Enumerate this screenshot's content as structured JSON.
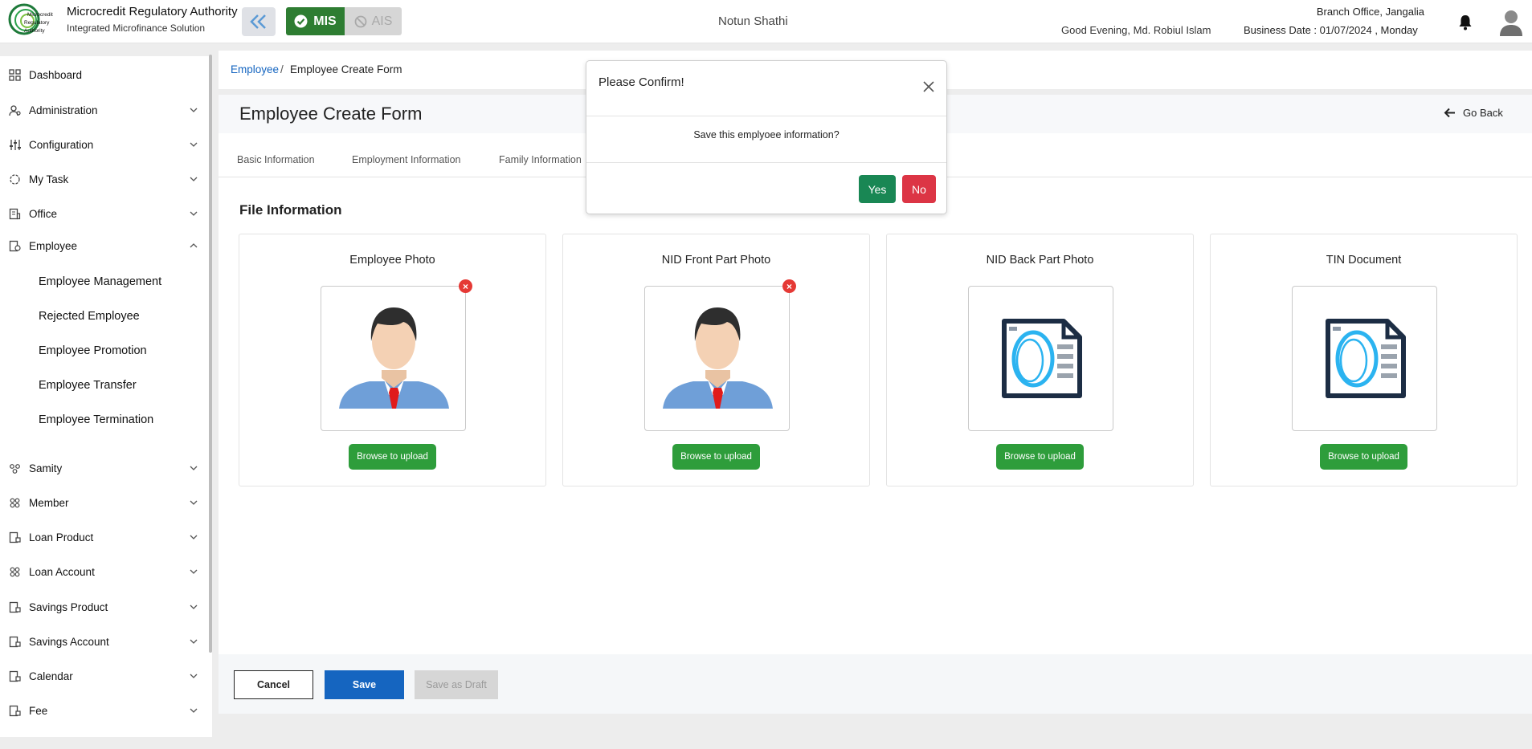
{
  "header": {
    "org_title": "Microcredit Regulatory Authority",
    "org_subtitle": "Integrated Microfinance Solution",
    "logo_text": [
      "Microcredit",
      "Regulatory",
      "Authority"
    ],
    "mis_label": "MIS",
    "ais_label": "AIS",
    "center_name": "Notun Shathi",
    "greeting": "Good Evening, Md. Robiul Islam",
    "branch": "Branch Office, Jangalia",
    "business_date": "Business Date : 01/07/2024 , Monday",
    "icons": {
      "collapse": "double-chevron-left-icon",
      "bell": "bell-icon",
      "avatar": "user-avatar-icon"
    }
  },
  "sidebar": {
    "items": [
      {
        "label": "Dashboard",
        "icon": "grid-icon"
      },
      {
        "label": "Administration",
        "icon": "users-gear-icon"
      },
      {
        "label": "Configuration",
        "icon": "sliders-icon"
      },
      {
        "label": "My Task",
        "icon": "task-icon"
      },
      {
        "label": "Office",
        "icon": "building-icon"
      },
      {
        "label": "Employee",
        "icon": "employee-icon"
      },
      {
        "label": "Samity",
        "icon": "group-icon"
      },
      {
        "label": "Member",
        "icon": "members-icon"
      },
      {
        "label": "Loan Product",
        "icon": "loan-product-icon"
      },
      {
        "label": "Loan Account",
        "icon": "loan-account-icon"
      },
      {
        "label": "Savings Product",
        "icon": "savings-product-icon"
      },
      {
        "label": "Savings Account",
        "icon": "savings-account-icon"
      },
      {
        "label": "Calendar",
        "icon": "calendar-icon"
      },
      {
        "label": "Fee",
        "icon": "fee-icon"
      }
    ],
    "employee_sub": [
      "Employee Management",
      "Rejected Employee",
      "Employee Promotion",
      "Employee Transfer",
      "Employee Termination"
    ]
  },
  "breadcrumb": {
    "link": "Employee",
    "separator": "/",
    "current": "Employee Create Form"
  },
  "page": {
    "title": "Employee Create Form",
    "go_back": "Go Back",
    "tabs": [
      "Basic Information",
      "Employment Information",
      "Family Information"
    ],
    "section_title": "File Information"
  },
  "cards": [
    {
      "title": "Employee Photo",
      "kind": "person",
      "upload": "Browse to upload"
    },
    {
      "title": "NID Front Part Photo",
      "kind": "person",
      "upload": "Browse to upload"
    },
    {
      "title": "NID Back Part Photo",
      "kind": "document",
      "upload": "Browse to upload"
    },
    {
      "title": "TIN Document",
      "kind": "document",
      "upload": "Browse to upload"
    }
  ],
  "footer": {
    "cancel": "Cancel",
    "save": "Save",
    "draft": "Save as Draft"
  },
  "modal": {
    "title": "Please Confirm!",
    "message": "Save this emplyoee information?",
    "yes": "Yes",
    "no": "No"
  },
  "colors": {
    "primary_blue": "#1565c0",
    "mis_green": "#2e7d32",
    "upload_green": "#2e9d3b",
    "yes_green": "#198754",
    "no_red": "#dc3545",
    "remove_red": "#e53935"
  }
}
